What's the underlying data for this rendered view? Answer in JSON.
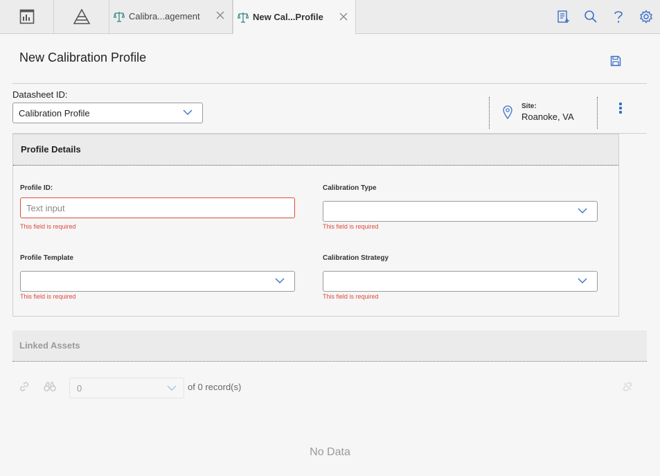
{
  "topbar": {
    "tabs": [
      {
        "label": "Calibra...agement",
        "active": false
      },
      {
        "label": "New Cal...Profile",
        "active": true
      }
    ]
  },
  "page": {
    "title": "New Calibration Profile"
  },
  "datasheet": {
    "label": "Datasheet ID:",
    "value": "Calibration Profile"
  },
  "site": {
    "label": "Site:",
    "value": "Roanoke, VA"
  },
  "profile_details": {
    "heading": "Profile Details",
    "profile_id": {
      "label": "Profile ID:",
      "placeholder": "Text input",
      "error": "This field is required"
    },
    "calibration_type": {
      "label": "Calibration Type",
      "error": "This field is required"
    },
    "profile_template": {
      "label": "Profile Template",
      "error": "This field is required"
    },
    "calibration_strategy": {
      "label": "Calibration Strategy",
      "error": "This field is required"
    }
  },
  "linked_assets": {
    "heading": "Linked Assets",
    "page_value": "0",
    "of_text": "of",
    "record_count": "0",
    "records_suffix": "record(s)",
    "empty_text": "No Data"
  },
  "colors": {
    "accent": "#3a6fc8",
    "error": "#e0483b",
    "tab_icon_teal": "#3f8f8a"
  }
}
